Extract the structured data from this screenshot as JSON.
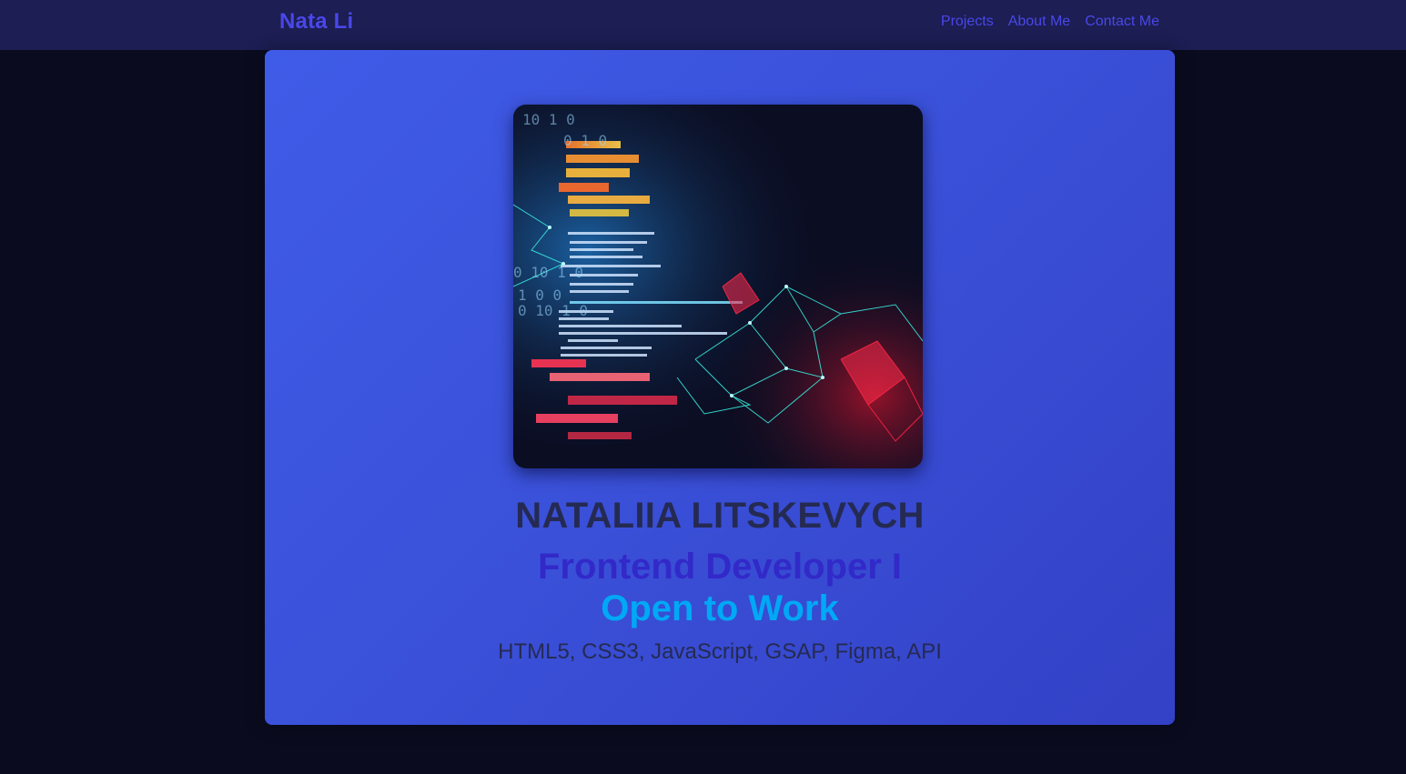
{
  "nav": {
    "brand": "Nata Li",
    "links": [
      "Projects",
      "About Me",
      "Contact Me"
    ]
  },
  "hero": {
    "image_description": "code-abstract-image",
    "name": "NATALIIA LITSKEVYCH",
    "role": "Frontend Developer I",
    "status": "Open to Work",
    "skills": "HTML5, CSS3, JavaScript, GSAP, Figma, API"
  },
  "colors": {
    "page_background": "#0a0b1e",
    "navbar_background": "#1c1e54",
    "accent_link": "#4a47e8",
    "hero_gradient_start": "#3f5ce8",
    "hero_gradient_end": "#3341c6",
    "name_text": "#252a52",
    "role_text": "#3229c9",
    "status_text": "#00a8f5"
  }
}
